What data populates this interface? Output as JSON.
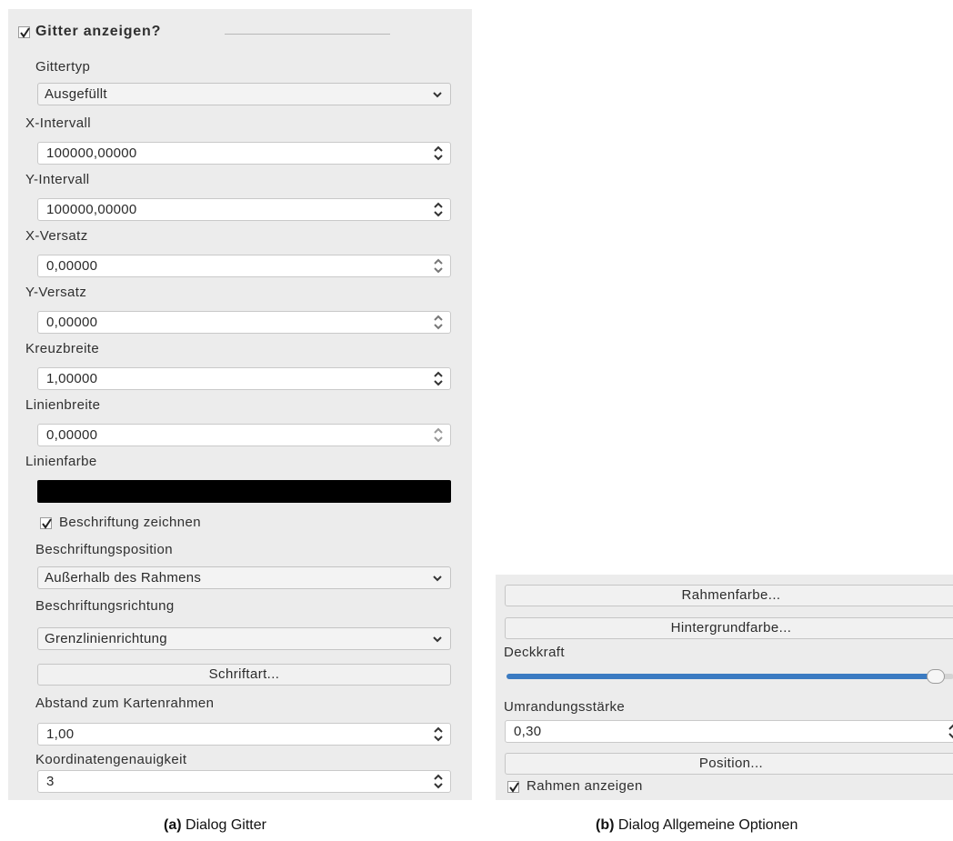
{
  "dialog_a": {
    "group_title": "Gitter anzeigen?",
    "group_checked": true,
    "grid_type": {
      "label": "Gittertyp",
      "value": "Ausgefüllt"
    },
    "x_interval": {
      "label": "X-Intervall",
      "value": "100000,00000"
    },
    "y_interval": {
      "label": "Y-Intervall",
      "value": "100000,00000"
    },
    "x_offset": {
      "label": "X-Versatz",
      "value": "0,00000"
    },
    "y_offset": {
      "label": "Y-Versatz",
      "value": "0,00000"
    },
    "cross_width": {
      "label": "Kreuzbreite",
      "value": "1,00000"
    },
    "line_width": {
      "label": "Linienbreite",
      "value": "0,00000"
    },
    "line_color": {
      "label": "Linienfarbe",
      "color": "#000000"
    },
    "draw_labels": {
      "label": "Beschriftung zeichnen",
      "checked": true
    },
    "label_position": {
      "label": "Beschriftungsposition",
      "value": "Außerhalb des Rahmens"
    },
    "label_direction": {
      "label": "Beschriftungsrichtung",
      "value": "Grenzlinienrichtung"
    },
    "font_button": "Schriftart...",
    "frame_distance": {
      "label": "Abstand zum Kartenrahmen",
      "value": "1,00"
    },
    "coord_precision": {
      "label": "Koordinatengenauigkeit",
      "value": "3"
    },
    "caption_prefix": "(a)",
    "caption_text": "Dialog Gitter"
  },
  "dialog_b": {
    "frame_color_button": "Rahmenfarbe...",
    "background_color_button": "Hintergrundfarbe...",
    "opacity": {
      "label": "Deckkraft",
      "value_fraction": 0.96
    },
    "outline_width": {
      "label": "Umrandungsstärke",
      "value": "0,30"
    },
    "position_button": "Position...",
    "show_frame": {
      "label": "Rahmen anzeigen",
      "checked": true
    },
    "caption_prefix": "(b)",
    "caption_text": "Dialog Allgemeine Optionen"
  },
  "colors": {
    "panel_bg": "#ececec",
    "slider_fill": "#3b7bc2",
    "line_color_swatch": "#000000"
  }
}
